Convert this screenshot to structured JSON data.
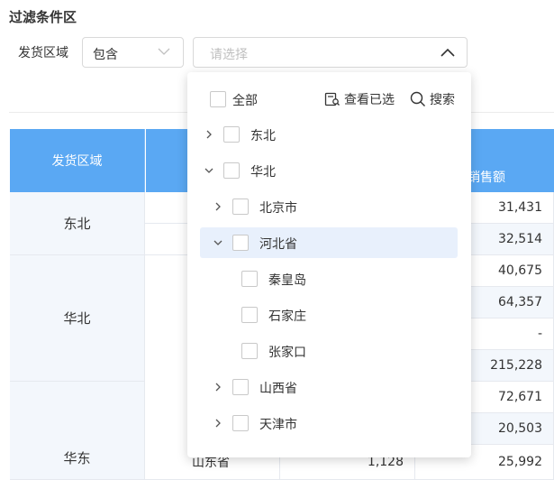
{
  "filter": {
    "section_title": "过滤条件区",
    "field_label": "发货区域",
    "mode_value": "包含",
    "value_placeholder": "请选择"
  },
  "dropdown": {
    "select_all_label": "全部",
    "view_selected_label": "查看已选",
    "search_label": "搜索",
    "tree": [
      {
        "label": "东北",
        "level": 0,
        "state": "collapsed"
      },
      {
        "label": "华北",
        "level": 0,
        "state": "expanded"
      },
      {
        "label": "北京市",
        "level": 1,
        "state": "collapsed"
      },
      {
        "label": "河北省",
        "level": 1,
        "state": "expanded",
        "highlighted": true
      },
      {
        "label": "秦皇岛",
        "level": 2,
        "state": "leaf"
      },
      {
        "label": "石家庄",
        "level": 2,
        "state": "leaf"
      },
      {
        "label": "张家口",
        "level": 2,
        "state": "leaf"
      },
      {
        "label": "山西省",
        "level": 1,
        "state": "collapsed"
      },
      {
        "label": "天津市",
        "level": 1,
        "state": "collapsed"
      }
    ]
  },
  "table": {
    "header_region": "发货区域",
    "header_sales_partial": "销售额",
    "regions": [
      "东北",
      "华北",
      "华东"
    ],
    "sales_values": [
      "31,431",
      "32,514",
      "40,675",
      "64,357",
      "-",
      "215,228",
      "72,671",
      "20,503",
      "25,992"
    ],
    "partial_row": {
      "province": "山东省",
      "qty": "1,128"
    }
  },
  "colors": {
    "header_bg": "#5aa8f3",
    "row_alt_bg": "#f3f7fc",
    "selected_row_bg": "#e8f0fc"
  }
}
